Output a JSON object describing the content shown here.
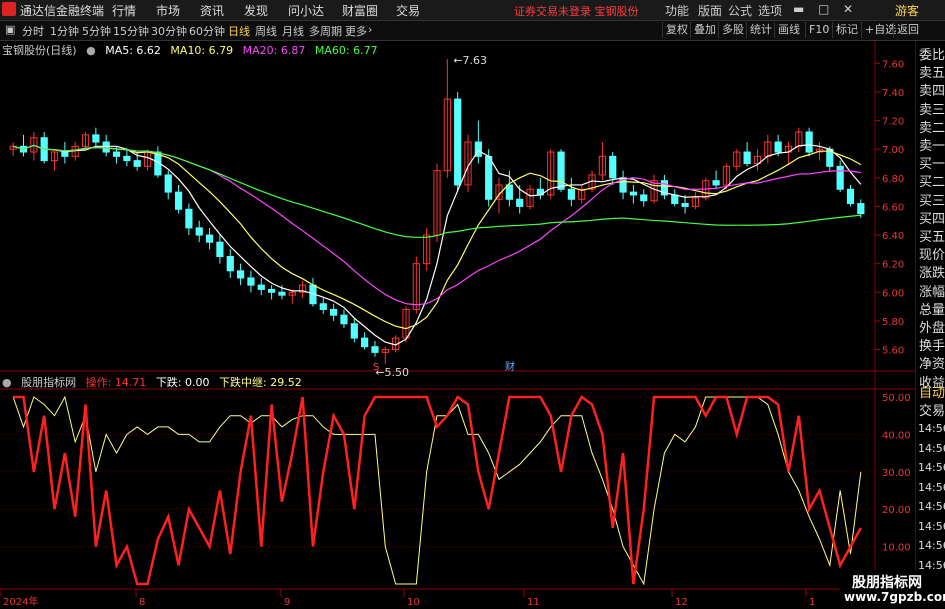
{
  "app": {
    "title": "通达信金融终端"
  },
  "menu": [
    "行情",
    "市场",
    "资讯",
    "发现",
    "问小达",
    "财富圈",
    "交易"
  ],
  "warning": "证券交易未登录  宝钢股份",
  "right_menu": [
    "功能",
    "版面",
    "公式",
    "选项"
  ],
  "guest": "游客",
  "periods": [
    "分时",
    "1分钟",
    "5分钟",
    "15分钟",
    "30分钟",
    "60分钟",
    "日线",
    "周线",
    "月线",
    "多周期",
    "更多"
  ],
  "active_period": "日线",
  "tools": [
    "复权",
    "叠加",
    "多股",
    "统计",
    "画线",
    "F10",
    "标记",
    "+自选",
    "返回"
  ],
  "stock": {
    "name": "宝钢股份(日线)",
    "ma5": "MA5: 6.62",
    "ma10": "MA10: 6.79",
    "ma20": "MA20: 6.87",
    "ma60": "MA60: 6.77"
  },
  "annotations": {
    "high": "7.63",
    "low": "5.50",
    "cai": "财",
    "s": "S"
  },
  "price_ticks": [
    "7.60",
    "7.40",
    "7.20",
    "7.00",
    "6.80",
    "6.60",
    "6.40",
    "6.20",
    "6.00",
    "5.80",
    "5.60"
  ],
  "indicator": {
    "name": "股朋指标网",
    "op": "操作: 14.71",
    "down": "下跌: 0.00",
    "mid": "下跌中继: 29.52"
  },
  "ind_ticks": [
    "50.00",
    "40.00",
    "30.00",
    "20.00",
    "10.00"
  ],
  "x_labels": [
    "2024年",
    "8",
    "9",
    "10",
    "11",
    "12",
    "1"
  ],
  "right_panel": [
    "委比",
    "卖五",
    "卖四",
    "卖三",
    "卖二",
    "卖一",
    "买一",
    "买二",
    "买三",
    "买四",
    "买五",
    "现价",
    "涨跌",
    "涨幅",
    "总量",
    "外盘",
    "换手",
    "净资",
    "收益"
  ],
  "right_panel2": [
    "自动",
    "交易"
  ],
  "right_times": [
    "14:56",
    "14:56",
    "14:56",
    "14:56",
    "14:56",
    "14:56",
    "14:56",
    "14:56",
    "14:56"
  ],
  "watermark": {
    "line1": "股朋指标网",
    "line2": "www.7gpzb.com"
  },
  "colors": {
    "up": "#ff3030",
    "down": "#54ffff",
    "ma5": "#ffffff",
    "ma10": "#ffff66",
    "ma20": "#ff44ff",
    "ma60": "#44ff44",
    "op": "#ff2020",
    "mid": "#ffff88"
  },
  "chart_data": {
    "type": "candlestick",
    "ylim": [
      5.45,
      7.7
    ],
    "ohlc": [
      [
        7.0,
        7.05,
        6.95,
        7.02
      ],
      [
        7.02,
        7.1,
        6.95,
        6.98
      ],
      [
        6.98,
        7.12,
        6.92,
        7.08
      ],
      [
        7.08,
        7.12,
        6.9,
        6.92
      ],
      [
        6.92,
        7.0,
        6.85,
        6.98
      ],
      [
        6.98,
        7.05,
        6.9,
        6.95
      ],
      [
        6.95,
        7.05,
        6.92,
        7.02
      ],
      [
        7.02,
        7.12,
        7.0,
        7.1
      ],
      [
        7.1,
        7.15,
        7.02,
        7.05
      ],
      [
        7.05,
        7.1,
        6.95,
        6.98
      ],
      [
        6.98,
        7.02,
        6.9,
        6.95
      ],
      [
        6.95,
        7.0,
        6.88,
        6.92
      ],
      [
        6.92,
        6.98,
        6.85,
        6.88
      ],
      [
        6.88,
        7.0,
        6.85,
        6.98
      ],
      [
        6.98,
        7.02,
        6.8,
        6.82
      ],
      [
        6.82,
        6.85,
        6.65,
        6.7
      ],
      [
        6.7,
        6.75,
        6.55,
        6.58
      ],
      [
        6.58,
        6.62,
        6.4,
        6.45
      ],
      [
        6.45,
        6.5,
        6.35,
        6.4
      ],
      [
        6.4,
        6.45,
        6.3,
        6.35
      ],
      [
        6.35,
        6.4,
        6.2,
        6.25
      ],
      [
        6.25,
        6.3,
        6.1,
        6.15
      ],
      [
        6.15,
        6.2,
        6.05,
        6.1
      ],
      [
        6.1,
        6.15,
        6.0,
        6.05
      ],
      [
        6.05,
        6.1,
        5.98,
        6.02
      ],
      [
        6.02,
        6.05,
        5.95,
        6.0
      ],
      [
        6.0,
        6.05,
        5.95,
        5.98
      ],
      [
        5.98,
        6.02,
        5.92,
        6.0
      ],
      [
        6.0,
        6.08,
        5.96,
        6.05
      ],
      [
        6.05,
        6.1,
        5.9,
        5.92
      ],
      [
        5.92,
        5.96,
        5.85,
        5.88
      ],
      [
        5.88,
        5.92,
        5.8,
        5.84
      ],
      [
        5.84,
        5.88,
        5.75,
        5.78
      ],
      [
        5.78,
        5.82,
        5.65,
        5.68
      ],
      [
        5.68,
        5.72,
        5.6,
        5.62
      ],
      [
        5.62,
        5.66,
        5.55,
        5.58
      ],
      [
        5.58,
        5.62,
        5.5,
        5.6
      ],
      [
        5.6,
        5.7,
        5.58,
        5.68
      ],
      [
        5.68,
        5.9,
        5.65,
        5.88
      ],
      [
        5.88,
        6.25,
        5.85,
        6.2
      ],
      [
        6.2,
        6.45,
        6.15,
        6.4
      ],
      [
        6.4,
        6.9,
        6.35,
        6.85
      ],
      [
        6.85,
        7.63,
        6.8,
        7.35
      ],
      [
        7.35,
        7.4,
        6.7,
        6.75
      ],
      [
        6.75,
        7.1,
        6.7,
        7.05
      ],
      [
        7.05,
        7.2,
        6.9,
        6.95
      ],
      [
        6.95,
        7.0,
        6.6,
        6.65
      ],
      [
        6.65,
        6.8,
        6.55,
        6.75
      ],
      [
        6.75,
        6.85,
        6.6,
        6.65
      ],
      [
        6.65,
        6.75,
        6.55,
        6.6
      ],
      [
        6.6,
        6.75,
        6.58,
        6.72
      ],
      [
        6.72,
        6.8,
        6.65,
        6.68
      ],
      [
        6.68,
        7.0,
        6.65,
        6.98
      ],
      [
        6.98,
        7.0,
        6.7,
        6.72
      ],
      [
        6.72,
        6.8,
        6.6,
        6.65
      ],
      [
        6.65,
        6.75,
        6.62,
        6.72
      ],
      [
        6.72,
        6.85,
        6.7,
        6.82
      ],
      [
        6.82,
        7.05,
        6.78,
        6.95
      ],
      [
        6.95,
        6.98,
        6.75,
        6.8
      ],
      [
        6.8,
        6.85,
        6.65,
        6.7
      ],
      [
        6.7,
        6.75,
        6.62,
        6.68
      ],
      [
        6.68,
        6.72,
        6.6,
        6.64
      ],
      [
        6.64,
        6.82,
        6.62,
        6.78
      ],
      [
        6.78,
        6.82,
        6.65,
        6.68
      ],
      [
        6.68,
        6.72,
        6.6,
        6.62
      ],
      [
        6.62,
        6.68,
        6.55,
        6.6
      ],
      [
        6.6,
        6.7,
        6.58,
        6.66
      ],
      [
        6.66,
        6.8,
        6.64,
        6.78
      ],
      [
        6.78,
        6.85,
        6.72,
        6.75
      ],
      [
        6.75,
        6.9,
        6.72,
        6.88
      ],
      [
        6.88,
        7.0,
        6.85,
        6.98
      ],
      [
        6.98,
        7.05,
        6.88,
        6.9
      ],
      [
        6.9,
        7.0,
        6.85,
        6.95
      ],
      [
        6.95,
        7.1,
        6.9,
        7.05
      ],
      [
        7.05,
        7.1,
        6.95,
        6.98
      ],
      [
        6.98,
        7.05,
        6.9,
        7.02
      ],
      [
        7.02,
        7.15,
        6.98,
        7.12
      ],
      [
        7.12,
        7.15,
        6.95,
        6.98
      ],
      [
        6.98,
        7.05,
        6.92,
        7.0
      ],
      [
        7.0,
        7.02,
        6.85,
        6.88
      ],
      [
        6.88,
        6.92,
        6.7,
        6.72
      ],
      [
        6.72,
        6.75,
        6.6,
        6.62
      ],
      [
        6.62,
        6.65,
        6.52,
        6.55
      ]
    ],
    "op_line": [
      50,
      50,
      30,
      45,
      20,
      35,
      18,
      48,
      10,
      25,
      5,
      10,
      0,
      0,
      12,
      18,
      5,
      20,
      15,
      10,
      25,
      8,
      30,
      45,
      10,
      48,
      22,
      35,
      50,
      10,
      30,
      45,
      40,
      20,
      45,
      50,
      50,
      50,
      50,
      50,
      50,
      42,
      45,
      50,
      48,
      30,
      20,
      35,
      50,
      50,
      50,
      50,
      45,
      30,
      45,
      50,
      48,
      40,
      15,
      35,
      0,
      20,
      50,
      50,
      50,
      50,
      50,
      45,
      50,
      50,
      40,
      50,
      50,
      50,
      48,
      30,
      45,
      20,
      25,
      15,
      5,
      10,
      15
    ],
    "mid_line": [
      50,
      42,
      50,
      48,
      45,
      50,
      38,
      45,
      30,
      40,
      35,
      40,
      42,
      40,
      42,
      42,
      40,
      40,
      38,
      38,
      42,
      45,
      45,
      43,
      45,
      45,
      42,
      44,
      45,
      45,
      42,
      40,
      40,
      40,
      40,
      40,
      10,
      0,
      0,
      0,
      30,
      45,
      45,
      48,
      40,
      40,
      35,
      28,
      30,
      32,
      35,
      38,
      42,
      45,
      45,
      45,
      35,
      28,
      20,
      10,
      5,
      0,
      20,
      35,
      40,
      38,
      42,
      50,
      50,
      50,
      50,
      50,
      50,
      48,
      40,
      30,
      25,
      18,
      12,
      5,
      25,
      8,
      30
    ]
  }
}
